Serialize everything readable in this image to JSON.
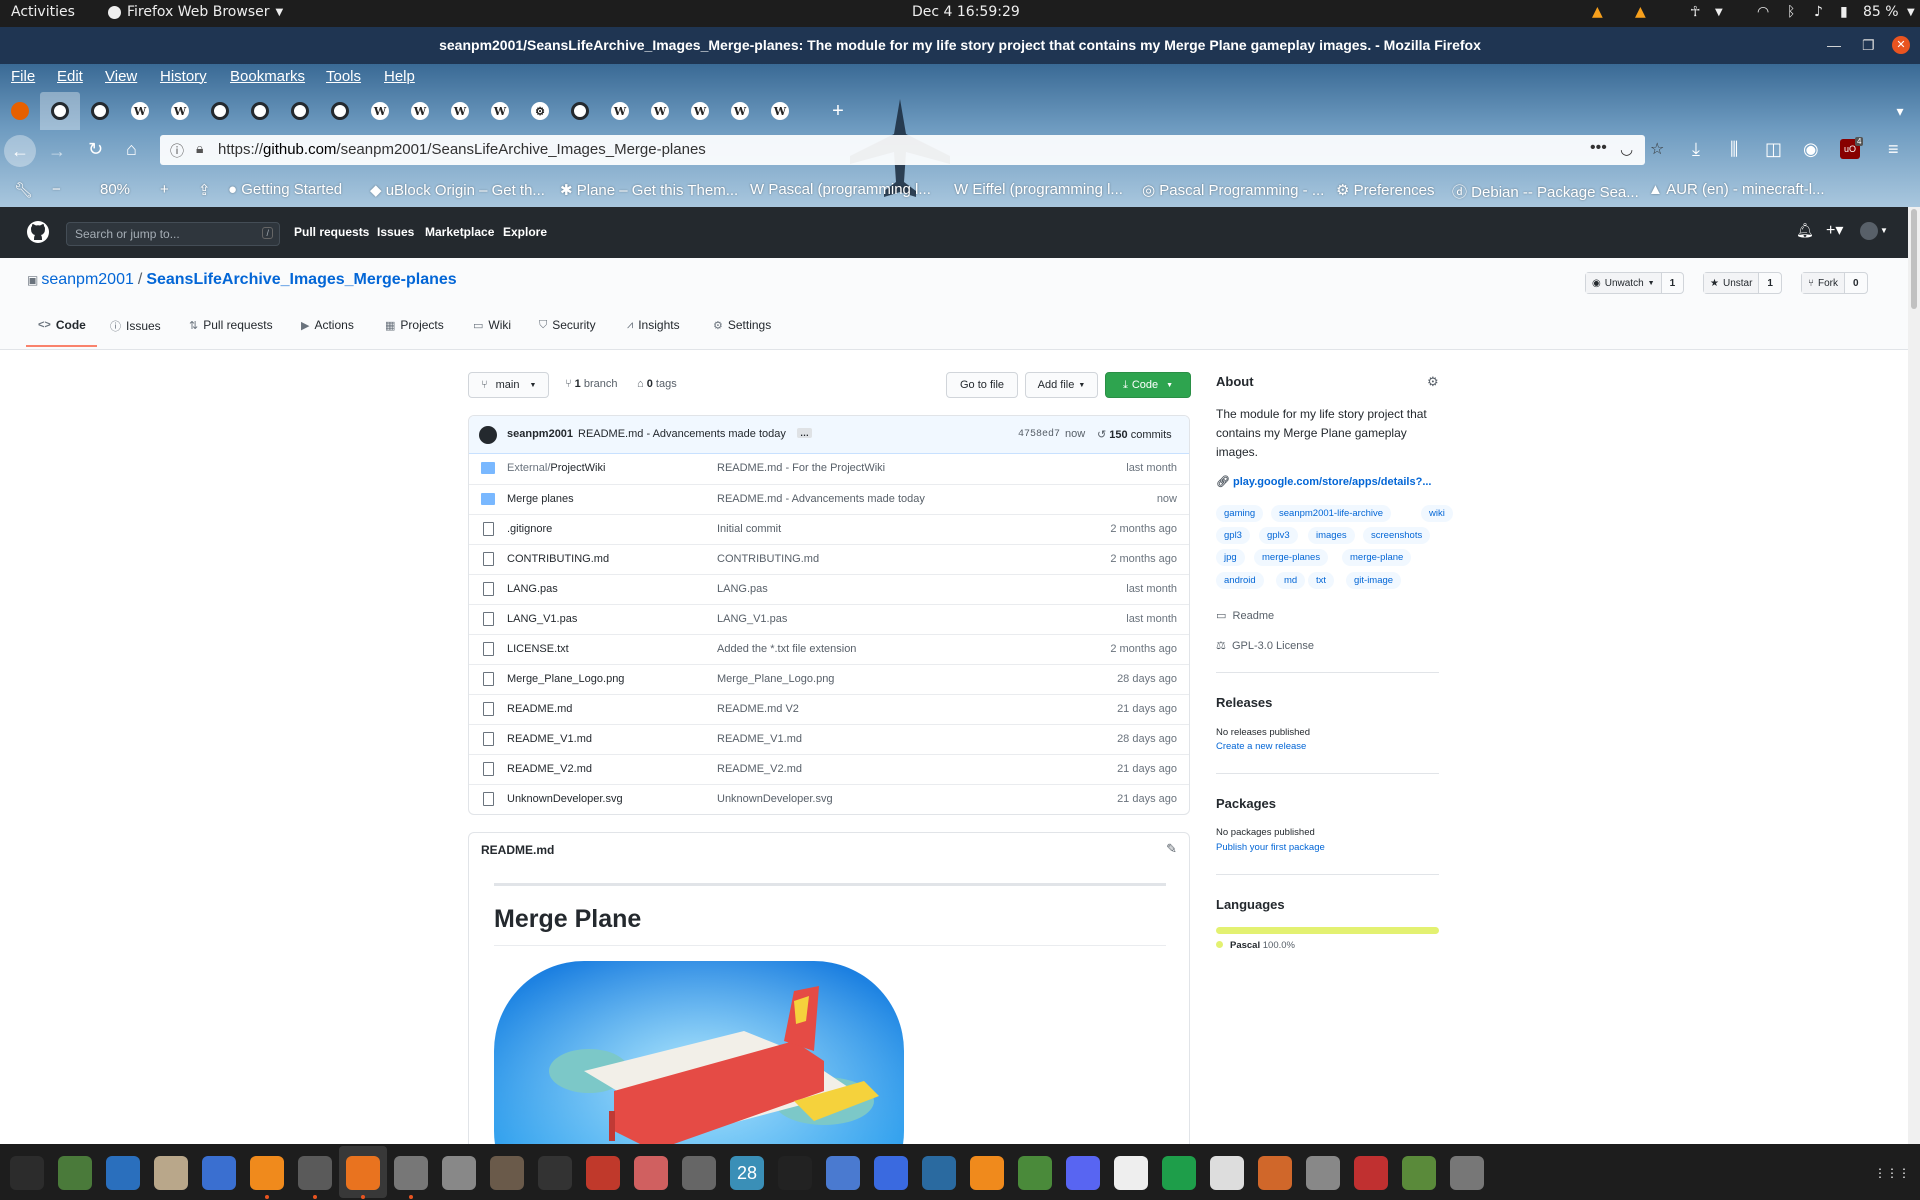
{
  "topbar": {
    "activities": "Activities",
    "app_menu": "Firefox Web Browser",
    "clock": "Dec 4  16:59:29",
    "battery": "85 %"
  },
  "window": {
    "title": "seanpm2001/SeansLifeArchive_Images_Merge-planes: The module for my life story project that contains my Merge Plane gameplay images. - Mozilla Firefox"
  },
  "menubar": [
    "File",
    "Edit",
    "View",
    "History",
    "Bookmarks",
    "Tools",
    "Help"
  ],
  "tabs": [
    "firefox",
    "github",
    "github",
    "W",
    "W",
    "github",
    "github",
    "github",
    "github",
    "W",
    "W",
    "W",
    "W",
    "settings",
    "github",
    "W",
    "W",
    "W",
    "W",
    "W"
  ],
  "urlbar": {
    "url_prefix": "https://",
    "url_host": "github.com",
    "url_path": "/seanpm2001/SeansLifeArchive_Images_Merge-planes",
    "notification_count": "4"
  },
  "bookmarks_toolbar": {
    "zoom": "80%",
    "items": [
      "Getting Started",
      "uBlock Origin – Get th...",
      "Plane – Get this Them...",
      "Pascal (programming l...",
      "Eiffel (programming l...",
      "Pascal Programming - ...",
      "Preferences",
      "Debian -- Package Sea...",
      "AUR (en) - minecraft-l..."
    ]
  },
  "github_header": {
    "search_placeholder": "Search or jump to...",
    "search_key": "/",
    "nav": [
      "Pull requests",
      "Issues",
      "Marketplace",
      "Explore"
    ]
  },
  "repo": {
    "owner": "seanpm2001",
    "name": "SeansLifeArchive_Images_Merge-planes",
    "watch_label": "Unwatch",
    "watch_count": "1",
    "star_label": "Unstar",
    "star_count": "1",
    "fork_label": "Fork",
    "fork_count": "0",
    "tabs": [
      "Code",
      "Issues",
      "Pull requests",
      "Actions",
      "Projects",
      "Wiki",
      "Security",
      "Insights",
      "Settings"
    ]
  },
  "branch_bar": {
    "branch": "main",
    "branch_count": "1",
    "branch_label": "branch",
    "tag_count": "0",
    "tag_label": "tags",
    "go_to_file": "Go to file",
    "add_file": "Add file",
    "code": "Code"
  },
  "latest_commit": {
    "author": "seanpm2001",
    "message": "README.md - Advancements made today",
    "sha": "4758ed7",
    "time": "now",
    "commit_count": "150",
    "commit_label": "commits"
  },
  "files": [
    {
      "prefix": "External/",
      "name": "ProjectWiki",
      "message": "README.md - For the ProjectWiki",
      "time": "last month",
      "type": "folder"
    },
    {
      "prefix": "",
      "name": "Merge planes",
      "message": "README.md - Advancements made today",
      "time": "now",
      "type": "folder"
    },
    {
      "prefix": "",
      "name": ".gitignore",
      "message": "Initial commit",
      "time": "2 months ago",
      "type": "file"
    },
    {
      "prefix": "",
      "name": "CONTRIBUTING.md",
      "message": "CONTRIBUTING.md",
      "time": "2 months ago",
      "type": "file"
    },
    {
      "prefix": "",
      "name": "LANG.pas",
      "message": "LANG.pas",
      "time": "last month",
      "type": "file"
    },
    {
      "prefix": "",
      "name": "LANG_V1.pas",
      "message": "LANG_V1.pas",
      "time": "last month",
      "type": "file"
    },
    {
      "prefix": "",
      "name": "LICENSE.txt",
      "message": "Added the *.txt file extension",
      "time": "2 months ago",
      "type": "file"
    },
    {
      "prefix": "",
      "name": "Merge_Plane_Logo.png",
      "message": "Merge_Plane_Logo.png",
      "time": "28 days ago",
      "type": "file"
    },
    {
      "prefix": "",
      "name": "README.md",
      "message": "README.md V2",
      "time": "21 days ago",
      "type": "file"
    },
    {
      "prefix": "",
      "name": "README_V1.md",
      "message": "README_V1.md",
      "time": "28 days ago",
      "type": "file"
    },
    {
      "prefix": "",
      "name": "README_V2.md",
      "message": "README_V2.md",
      "time": "21 days ago",
      "type": "file"
    },
    {
      "prefix": "",
      "name": "UnknownDeveloper.svg",
      "message": "UnknownDeveloper.svg",
      "time": "21 days ago",
      "type": "file"
    }
  ],
  "readme": {
    "filename": "README.md",
    "heading": "Merge Plane"
  },
  "about": {
    "heading": "About",
    "description": "The module for my life story project that contains my Merge Plane gameplay images.",
    "link": "play.google.com/store/apps/details?...",
    "topics": [
      "gaming",
      "seanpm2001-life-archive",
      "wiki",
      "gpl3",
      "gplv3",
      "images",
      "screenshots",
      "jpg",
      "merge-planes",
      "merge-plane",
      "android",
      "md",
      "txt",
      "git-image"
    ],
    "readme_label": "Readme",
    "license_label": "GPL-3.0 License"
  },
  "releases": {
    "heading": "Releases",
    "empty": "No releases published",
    "link": "Create a new release"
  },
  "packages": {
    "heading": "Packages",
    "empty": "No packages published",
    "link": "Publish your first package"
  },
  "languages": {
    "heading": "Languages",
    "items": [
      {
        "name": "Pascal",
        "percent": "100.0%",
        "fraction": 1.0,
        "color": "#e3f171"
      }
    ]
  },
  "taskbar": {
    "calendar_day": "28"
  }
}
